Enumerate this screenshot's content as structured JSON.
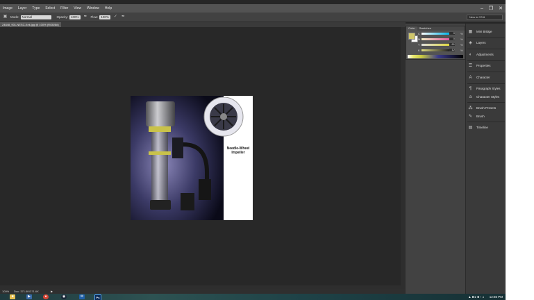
{
  "menu": {
    "items": [
      "Image",
      "Layer",
      "Type",
      "Select",
      "Filter",
      "View",
      "Window",
      "Help"
    ]
  },
  "window_controls": {
    "minimize": "–",
    "restore": "❐",
    "close": "✕"
  },
  "options_bar": {
    "mode_label": "Mode:",
    "mode_value": "Normal",
    "opacity_label": "Opacity:",
    "opacity_value": "100%",
    "flow_label": "Flow:",
    "flow_value": "100%",
    "workspace": "New in CS 6"
  },
  "document_tab": {
    "label": "24848_901-NESC-Kek.jpg @ 100% (RGB/8#)"
  },
  "status_bar": {
    "zoom": "100%",
    "doc_size": "Doc: 371.6K/371.6K"
  },
  "image_overlay": {
    "caption_line1": "Needle-Wheel",
    "caption_line2": "Impeller"
  },
  "color_panel": {
    "tabs": [
      "Color",
      "Swatches"
    ],
    "rows": [
      {
        "letter": "C",
        "value": "0"
      },
      {
        "letter": "M",
        "value": "0"
      },
      {
        "letter": "Y",
        "value": "61"
      },
      {
        "letter": "K",
        "value": "12"
      }
    ],
    "percent_sign": "%",
    "foreground_color": "#cfc66a",
    "background_color": "#ffffff"
  },
  "dock_panels": [
    {
      "label": "Mini Bridge",
      "icon": "mini-bridge-icon",
      "glyph": "▦"
    },
    {
      "label": "Layers",
      "icon": "layers-icon",
      "glyph": "◈"
    },
    {
      "label": "Adjustments",
      "icon": "adjustments-icon",
      "glyph": "◐"
    },
    {
      "label": "Properties",
      "icon": "properties-icon",
      "glyph": "☰"
    },
    {
      "label": "Character",
      "icon": "character-icon",
      "glyph": "A"
    },
    {
      "label": "Paragraph Styles",
      "icon": "paragraph-styles-icon",
      "glyph": "¶"
    },
    {
      "label": "Character Styles",
      "icon": "character-styles-icon",
      "glyph": "a"
    },
    {
      "label": "Brush Presets",
      "icon": "brush-presets-icon",
      "glyph": "⁂"
    },
    {
      "label": "Brush",
      "icon": "brush-icon",
      "glyph": "✎"
    },
    {
      "label": "Timeline",
      "icon": "timeline-icon",
      "glyph": "▤"
    }
  ],
  "taskbar": {
    "apps": [
      {
        "icon": "file-explorer-icon",
        "glyph": "■",
        "color": "#e8c050"
      },
      {
        "icon": "media-player-icon",
        "glyph": "▶",
        "color": "#3a6aa8"
      },
      {
        "icon": "chrome-icon",
        "glyph": "●",
        "color": "#d64535"
      },
      {
        "icon": "steam-icon",
        "glyph": "◉",
        "color": "#1b2838"
      },
      {
        "icon": "outlook-icon",
        "glyph": "✉",
        "color": "#1f5fa8"
      },
      {
        "icon": "photoshop-icon",
        "glyph": "Ps",
        "color": "#0b2a55"
      }
    ],
    "clock": "12:55 PM"
  },
  "colors": {
    "app_bg": "#262626",
    "menubar": "#535353",
    "panel": "#424242",
    "accent_yellow": "#cfc66a"
  }
}
